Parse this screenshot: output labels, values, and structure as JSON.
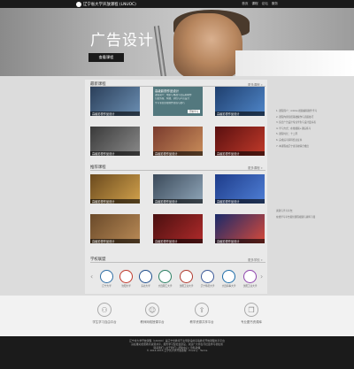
{
  "header": {
    "site_name": "辽宁省大学开放课程 (LNUOC)",
    "nav": [
      "首页",
      "课程",
      "论坛",
      "服务"
    ]
  },
  "hero": {
    "title": "广告设计",
    "button": "查看课程"
  },
  "sections": {
    "latest": {
      "title": "最新课程",
      "more": "更多课程 »"
    },
    "recommended": {
      "title": "推荐课程",
      "more": "更多课程 »"
    },
    "schools": {
      "title": "学校联盟",
      "more": "更多学校 »"
    }
  },
  "feature_course": {
    "title": "高级影视作品设计",
    "desc": [
      "课程简介：电影与电视节目后期制作",
      "包括剪辑、特效、调色与声音设计",
      "学习专业影视制作流程与技巧"
    ],
    "button": "开始学习"
  },
  "latest_cards": [
    "高级影视作品设计",
    "高级影视作品设计",
    "高级影视作品设计",
    "高级影视作品设计",
    "高级影视作品设计",
    "高级影视作品设计",
    "高级影视作品设计"
  ],
  "recommended_cards": [
    "高级影视作品设计",
    "高级影视作品设计",
    "高级影视作品设计",
    "高级影视作品设计",
    "高级影视作品设计",
    "高级影视作品设计"
  ],
  "schools": [
    {
      "name": "辽宁大学",
      "color": "#2e6da4"
    },
    {
      "name": "沈阳大学",
      "color": "#c0392b"
    },
    {
      "name": "东北大学",
      "color": "#1f4e8c"
    },
    {
      "name": "大连理工大学",
      "color": "#2a7f62"
    },
    {
      "name": "沈阳工业大学",
      "color": "#b03a2e"
    },
    {
      "name": "辽宁师范大学",
      "color": "#3b5998"
    },
    {
      "name": "大连海事大学",
      "color": "#1b6ca8"
    },
    {
      "name": "沈阳工业大学",
      "color": "#8e44ad"
    }
  ],
  "side_text": [
    "1. 课程简介：Adobe 视频编辑软件学习",
    "2. 课程内容包括基础操作与高级技巧",
    "3. 适合广告设计专业学生与设计爱好者",
    "4. 学习方式：在线视频+课后练习",
    "5. 课程时长：十二周",
    "6. 完成后可获得结业证书",
    "7. 本课程由辽宁省高校联合推出",
    "资源与学习平台：",
    "在线学习平台提供课程视频与资料下载"
  ],
  "features": [
    {
      "label": "学生学习自由平台",
      "icon": "people-icon"
    },
    {
      "label": "教师网络授课平台",
      "icon": "teacher-icon"
    },
    {
      "label": "教学资源共享平台",
      "icon": "upload-icon"
    },
    {
      "label": "专业图书资源库",
      "icon": "book-icon"
    }
  ],
  "footer": [
    "辽宁省大学开放课程（LNUOC）是辽宁省教育厅主导建设的高等教育开放课程共享平台",
    "旨在推动优质教育资源共享，服务学习型社会建设，欢迎广大师生与社会学习者使用",
    "联系我们 | 关于我们 | 帮助中心 | 隐私政策",
    "© 2014-2015 辽宁省大学开放课程 · Privacy · Terms"
  ],
  "colors": {
    "topbar": "#1a1a1a",
    "footer": "#1b1b1b",
    "feature_bg": "#53787e"
  }
}
